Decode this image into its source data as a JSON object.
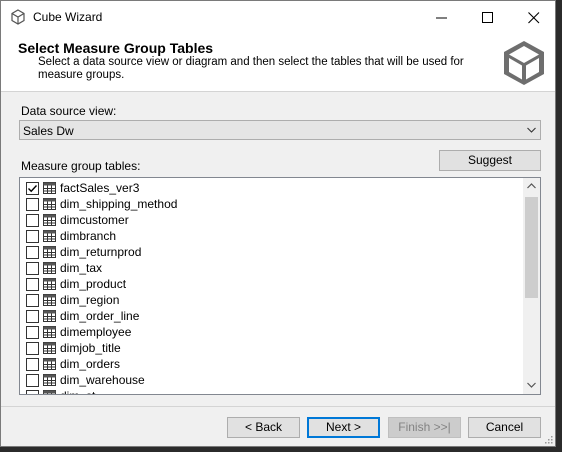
{
  "window": {
    "title": "Cube Wizard",
    "icon": "cube-icon"
  },
  "header": {
    "title": "Select Measure Group Tables",
    "description": "Select a data source view or diagram and then select the tables that will be used for measure groups."
  },
  "data_source": {
    "label": "Data source view:",
    "selected": "Sales Dw"
  },
  "measure_tables": {
    "label": "Measure group tables:",
    "suggest_label": "Suggest",
    "items": [
      {
        "name": "factSales_ver3",
        "checked": true
      },
      {
        "name": "dim_shipping_method",
        "checked": false
      },
      {
        "name": "dimcustomer",
        "checked": false
      },
      {
        "name": "dimbranch",
        "checked": false
      },
      {
        "name": "dim_returnprod",
        "checked": false
      },
      {
        "name": "dim_tax",
        "checked": false
      },
      {
        "name": "dim_product",
        "checked": false
      },
      {
        "name": "dim_region",
        "checked": false
      },
      {
        "name": "dim_order_line",
        "checked": false
      },
      {
        "name": "dimemployee",
        "checked": false
      },
      {
        "name": "dimjob_title",
        "checked": false
      },
      {
        "name": "dim_orders",
        "checked": false
      },
      {
        "name": "dim_warehouse",
        "checked": false
      },
      {
        "name": "dim_st",
        "checked": false
      }
    ]
  },
  "buttons": {
    "back": "< Back",
    "next": "Next >",
    "finish": "Finish >>|",
    "cancel": "Cancel"
  },
  "colors": {
    "accent": "#0078d7",
    "window_bg": "#f0f0f0"
  }
}
